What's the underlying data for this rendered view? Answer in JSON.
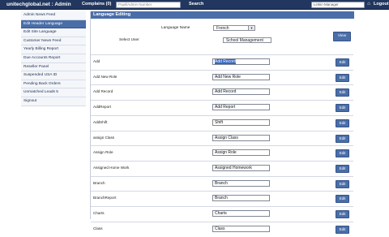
{
  "topbar": {
    "brand": "unitechglobal.net : Admin",
    "complains": "Complains (0)",
    "search_placeholder": "Pupil/Admin Number",
    "search_label": "Search",
    "user_select": "Linkin Manager",
    "logout": "Logout"
  },
  "sidebar": {
    "items": [
      {
        "label": "Admin News Feed"
      },
      {
        "label": "Edit Header Language",
        "active": true
      },
      {
        "label": "Edit Site Language"
      },
      {
        "label": "Customer News Feed"
      },
      {
        "label": "Yearly Billing Report"
      },
      {
        "label": "Due Accounts Report"
      },
      {
        "label": "Reseller Panel"
      },
      {
        "label": "Suspended USA ID"
      },
      {
        "label": "Pending Back Orders"
      },
      {
        "label": "Unmatched Leads 5"
      },
      {
        "label": "Signout"
      }
    ]
  },
  "main": {
    "title": "Language Editing",
    "filters": {
      "language_label": "Language Name",
      "language_value": "French",
      "user_label": "Select User",
      "user_value": "School Management",
      "view_button": "View"
    },
    "edit_label": "Edit",
    "rows": [
      {
        "key": "Add",
        "value": "Add Record",
        "selected": true
      },
      {
        "key": "Add New Role",
        "value": "Add New Role"
      },
      {
        "key": "Add Record",
        "value": "Add Record"
      },
      {
        "key": "AddReport",
        "value": "Add Report"
      },
      {
        "key": "AddShift",
        "value": "Shift"
      },
      {
        "key": "assign Class",
        "value": "Assign Class"
      },
      {
        "key": "Assign Role",
        "value": "Assign Role"
      },
      {
        "key": "Assigned Home Work",
        "value": "Assigned Homework"
      },
      {
        "key": "Branch",
        "value": "Branch"
      },
      {
        "key": "BranchReport",
        "value": "Branch"
      },
      {
        "key": "Charts",
        "value": "Charts"
      },
      {
        "key": "Class",
        "value": "Class"
      }
    ]
  }
}
